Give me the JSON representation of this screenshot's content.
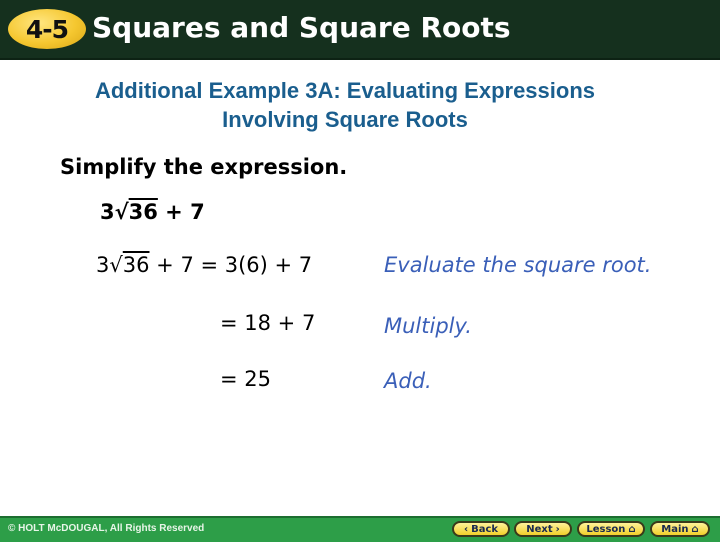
{
  "header": {
    "lesson_badge": "4-5",
    "title": "Squares and Square Roots"
  },
  "subtitle": {
    "line1": "Additional Example 3A: Evaluating Expressions",
    "line2": "Involving Square Roots"
  },
  "instruction": "Simplify the expression.",
  "expression": {
    "coefficient": "3",
    "radical_symbol": "√",
    "radicand": "36",
    "rest": " + 7"
  },
  "steps": [
    {
      "prefix": "3",
      "radical_symbol": "√",
      "radicand": "36",
      "work": " + 7 = 3(6) + 7",
      "explanation": "Evaluate the square root."
    },
    {
      "work": "= 18 + 7",
      "explanation": "Multiply."
    },
    {
      "work": "= 25",
      "explanation": "Add."
    }
  ],
  "footer": {
    "copyright": "© HOLT McDOUGAL, All Rights Reserved",
    "nav": {
      "back": "Back",
      "back_icon": "‹",
      "next": "Next",
      "next_icon": "›",
      "lesson": "Lesson",
      "main": "Main",
      "home_icon": "⌂"
    }
  },
  "colors": {
    "header_bg": "#15301e",
    "badge": "#f5c730",
    "subtitle": "#1a5e8e",
    "explanation": "#3a5fb8",
    "footer_bg": "#2d9e48",
    "button": "#f1cf2a"
  }
}
